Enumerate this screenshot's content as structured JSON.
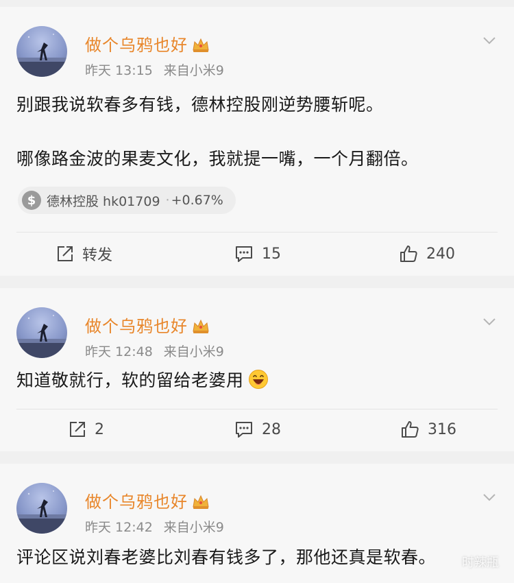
{
  "posts": [
    {
      "author": "做个乌鸦也好",
      "time": "昨天 13:15",
      "source": "来自小米9",
      "text_lines": [
        "别跟我说软春多有钱，德林控股刚逆势腰斩呢。",
        "哪像路金波的果麦文化，我就提一嘴，一个月翻倍。"
      ],
      "stock_chip": {
        "name": "德林控股 hk01709",
        "separator": "·",
        "change": "+0.67%"
      },
      "actions": {
        "repost": "转发",
        "comments": "15",
        "likes": "240"
      }
    },
    {
      "author": "做个乌鸦也好",
      "time": "昨天 12:48",
      "source": "来自小米9",
      "text": "知道敬就行，软的留给老婆用",
      "actions": {
        "repost": "2",
        "comments": "28",
        "likes": "316"
      }
    },
    {
      "author": "做个乌鸦也好",
      "time": "昨天 12:42",
      "source": "来自小米9",
      "text": "评论区说刘春老婆比刘春有钱多了，那他还真是软春。"
    }
  ],
  "watermark": "时辣瓶",
  "colors": {
    "author": "#e8862a",
    "meta": "#8a8a8a",
    "text": "#1a1a1a"
  },
  "icons": [
    "chevron-down-icon",
    "crown-icon",
    "dollar-icon",
    "repost-icon",
    "comment-icon",
    "like-icon",
    "laugh-emoji-icon"
  ]
}
